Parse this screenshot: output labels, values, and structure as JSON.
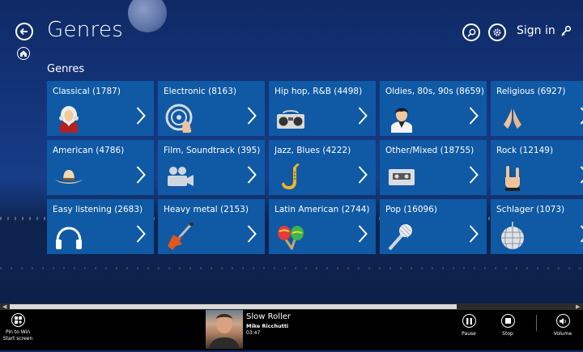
{
  "header": {
    "title": "Genres",
    "section_label": "Genres",
    "sign_in_label": "Sign in"
  },
  "tiles": [
    {
      "label": "Classical (1787)",
      "icon": "composer-icon"
    },
    {
      "label": "Electronic (8163)",
      "icon": "turntable-icon"
    },
    {
      "label": "Hip hop, R&B (4498)",
      "icon": "boombox-icon"
    },
    {
      "label": "Oldies, 80s, 90s (8659)",
      "icon": "elvis-icon"
    },
    {
      "label": "Religious (6927)",
      "icon": "praying-hands-icon"
    },
    {
      "label": "American (4786)",
      "icon": "cowboy-hat-icon"
    },
    {
      "label": "Film, Soundtrack (395)",
      "icon": "film-camera-icon"
    },
    {
      "label": "Jazz, Blues (4222)",
      "icon": "saxophone-icon"
    },
    {
      "label": "Other/Mixed (18755)",
      "icon": "cassette-icon"
    },
    {
      "label": "Rock (12149)",
      "icon": "rock-hand-icon"
    },
    {
      "label": "Easy listening (2683)",
      "icon": "headphones-icon"
    },
    {
      "label": "Heavy metal (2153)",
      "icon": "electric-guitar-icon"
    },
    {
      "label": "Latin American (2744)",
      "icon": "maracas-icon"
    },
    {
      "label": "Pop (16096)",
      "icon": "microphone-icon"
    },
    {
      "label": "Schlager (1073)",
      "icon": "disco-ball-icon"
    }
  ],
  "appbar": {
    "pin_label": "Pin to Win Start screen",
    "now_playing": {
      "song": "Slow Roller",
      "artist": "Mike Ricchutti",
      "time": "03:47"
    },
    "pause_label": "Pause",
    "stop_label": "Stop",
    "volume_label": "Volume"
  },
  "colors": {
    "tile": "#0f59a5",
    "appbar": "#000000"
  }
}
